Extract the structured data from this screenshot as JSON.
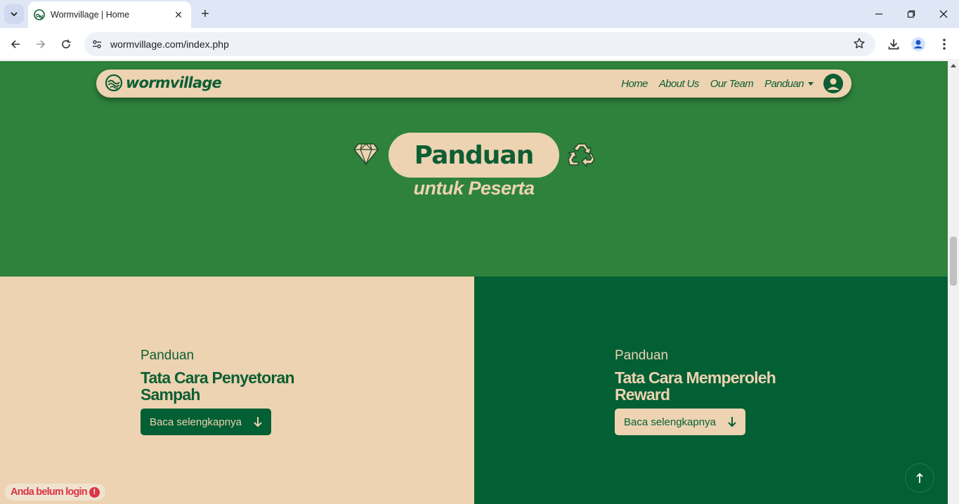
{
  "browser": {
    "tab_title": "Wormvillage | Home",
    "url": "wormvillage.com/index.php"
  },
  "site": {
    "brand": "wormvillage",
    "nav": {
      "home": "Home",
      "about": "About Us",
      "team": "Our Team",
      "panduan": "Panduan"
    }
  },
  "hero": {
    "title": "Panduan",
    "subtitle": "untuk Peserta"
  },
  "cards": [
    {
      "kicker": "Panduan",
      "title": "Tata Cara Penyetoran Sampah",
      "button": "Baca selengkapnya"
    },
    {
      "kicker": "Panduan",
      "title": "Tata Cara Memperoleh Reward",
      "button": "Baca selengkapnya"
    }
  ],
  "login_status": "Anda belum login",
  "colors": {
    "hero_green": "#2e823c",
    "dark_green": "#035f34",
    "beige": "#edd3b1",
    "alert_red": "#dc3545"
  },
  "icons": {
    "hero_left": "gem-icon",
    "hero_right": "recycle-icon",
    "scroll_top": "arrow-up-icon"
  }
}
